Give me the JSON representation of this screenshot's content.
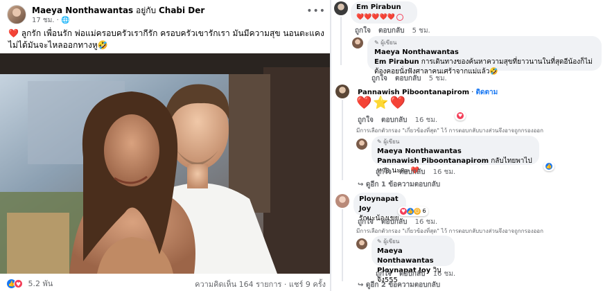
{
  "post": {
    "author": "Maeya Nonthawantas",
    "with_text": "อยู่กับ",
    "with_name": "Chabi Der",
    "time": "17 ชม.",
    "caption": "❤️ ลูกรัก เพื่อนรัก พ่อแม่ครอบครัวเรากีรัก ครอบครัวเขารักเรา มันมีความสุข นอนตะแคงไม่ได้มันจะไหลออกทางหู🤣",
    "menu": "•••",
    "reactions_count": "5.2 พัน",
    "comments_count": "ความคิดเห็น 164 รายการ",
    "shares_count": "แชร์ 9 ครั้ง"
  },
  "comments": [
    {
      "name": "Em Pirabun",
      "text": "❤️❤️❤️❤️❤️",
      "like": "ถูกใจ",
      "reply": "ตอบกลับ",
      "time": "5 ชม.",
      "reply_item": {
        "tag": "ผู้เขียน",
        "name": "Maeya Nonthawantas",
        "mention": "Em Pirabun",
        "text": "การเดินทางของค้นหาความสุขที่ยาวนานในที่สุดอีน้องก็ไม่ต้องคอยนั่งฟังศาลาคนเศร้าจากแม่แล้ว🤣",
        "like": "ถูกใจ",
        "reply": "ตอบกลับ",
        "time": "5 ชม."
      }
    },
    {
      "name": "Pannawish Piboontanapirom",
      "follow": "ติดตาม",
      "text": "❤️⭐❤️",
      "like": "ถูกใจ",
      "reply": "ตอบกลับ",
      "time": "16 ชม.",
      "filter_note": "มีการเลือกตัวกรอง \"เกี่ยวข้องที่สุด\" ไว้ การตอบกลับบางส่วนจึงอาจถูกกรองออก",
      "reply_item": {
        "tag": "ผู้เขียน",
        "name": "Maeya Nonthawantas",
        "mention": "Pannawish Piboontanapirom",
        "text": "กลับไทยพาไปหาอ.นะคะ ❤️",
        "like": "ถูกใจ",
        "reply": "ตอบกลับ",
        "time": "16 ชม."
      },
      "more_replies": "↪ ดูอีก 1 ข้อความตอบกลับ"
    },
    {
      "name": "Ploynapat Joy",
      "text": "รักนะน้องเขย",
      "reaction_count": "6",
      "like": "ถูกใจ",
      "reply": "ตอบกลับ",
      "time": "16 ชม.",
      "filter_note": "มีการเลือกตัวกรอง \"เกี่ยวข้องที่สุด\" ไว้ การตอบกลับบางส่วนจึงอาจถูกกรองออก",
      "reply_item": {
        "tag": "ผู้เขียน",
        "name": "Maeya Nonthawantas",
        "mention": "Ploynapat Joy",
        "text": "วิบจัง555",
        "like": "ถูกใจ",
        "reply": "ตอบกลับ",
        "time": "16 ชม."
      },
      "more_replies": "↪ ดูอีก 2 ข้อความตอบกลับ"
    }
  ],
  "colors": {
    "like": "#1877f2",
    "love": "#f33e58",
    "bubble": "#f0f2f5",
    "meta": "#65676b"
  },
  "icons": [
    "like-icon",
    "love-icon",
    "haha-icon",
    "pencil-icon",
    "reply-arrow-icon",
    "more-icon"
  ]
}
